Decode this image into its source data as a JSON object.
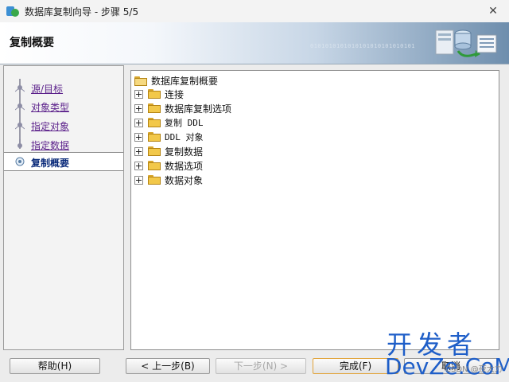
{
  "window": {
    "title": "数据库复制向导 - 步骤 5/5",
    "close_glyph": "✕"
  },
  "header": {
    "title": "复制概要",
    "binary_text": "0101010101010101010101010101"
  },
  "steps": [
    {
      "label": "源/目标",
      "active": false
    },
    {
      "label": "对象类型",
      "active": false
    },
    {
      "label": "指定对象",
      "active": false
    },
    {
      "label": "指定数据",
      "active": false
    },
    {
      "label": "复制概要",
      "active": true
    }
  ],
  "tree": {
    "root": "数据库复制概要",
    "nodes": [
      {
        "label": "连接"
      },
      {
        "label": "数据库复制选项"
      },
      {
        "label": "复制 DDL"
      },
      {
        "label": "DDL 对象"
      },
      {
        "label": "复制数据"
      },
      {
        "label": "数据选项"
      },
      {
        "label": "数据对象"
      }
    ]
  },
  "buttons": {
    "help": "帮助(H)",
    "back": "< 上一步(B)",
    "next": "下一步(N) >",
    "finish": "完成(F)",
    "cancel": "取消"
  },
  "watermark": {
    "cn": "开发者",
    "en": "DevZe.CoM",
    "csdn": "CSDN @夜大力"
  },
  "colors": {
    "link": "#5a1f8a",
    "active_step": "#0a2a7a",
    "folder": "#f2c84a",
    "watermark": "#1e5ec8"
  }
}
